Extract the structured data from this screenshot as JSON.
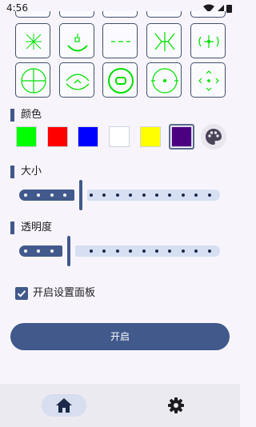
{
  "status_bar": {
    "time": "4:56"
  },
  "crosshair_options": {
    "items": [
      {
        "icon": "crosshair-x-icon"
      },
      {
        "icon": "crosshair-arc-square-icon"
      },
      {
        "icon": "crosshair-dash-icon"
      },
      {
        "icon": "crosshair-brackets-icon"
      },
      {
        "icon": "crosshair-circle-ticks-icon"
      },
      {
        "icon": "crosshair-circle-cross-icon"
      },
      {
        "icon": "crosshair-arc-chevron-icon"
      },
      {
        "icon": "crosshair-ring-bracket-icon"
      },
      {
        "icon": "crosshair-circle-dot-icon"
      },
      {
        "icon": "crosshair-diamond-arrows-icon"
      }
    ],
    "color": "#00e000"
  },
  "color_section": {
    "title": "颜色",
    "swatches": [
      {
        "color": "#00ff00"
      },
      {
        "color": "#ff0000"
      },
      {
        "color": "#0000ff"
      },
      {
        "color": "#ffffff"
      },
      {
        "color": "#ffff00"
      },
      {
        "color": "#4b0082"
      }
    ],
    "selected_index": 5,
    "custom_icon": "palette-icon"
  },
  "size_section": {
    "title": "大小",
    "value_fraction": 0.3
  },
  "opacity_section": {
    "title": "透明度",
    "value_fraction": 0.24
  },
  "settings_panel": {
    "label": "开启设置面板",
    "checked": true
  },
  "start_button": {
    "label": "开启"
  },
  "bottom_nav": {
    "items": [
      {
        "icon": "home-icon",
        "selected": true
      },
      {
        "icon": "settings-icon",
        "selected": false
      }
    ]
  },
  "colors": {
    "accent": "#41598b",
    "track_inactive": "#d7dff2",
    "background": "#f7f5fb"
  }
}
